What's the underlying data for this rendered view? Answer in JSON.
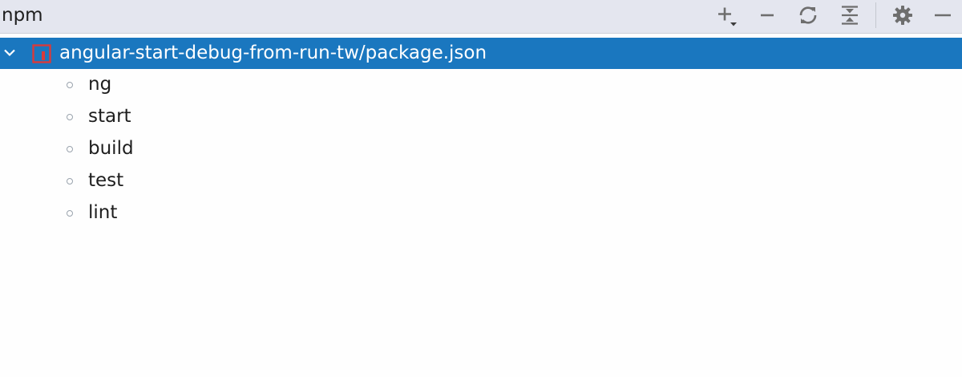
{
  "window": {
    "title": "npm"
  },
  "toolbar": {
    "icons": [
      "add-icon",
      "remove-icon",
      "reload-icon",
      "collapse-all-icon",
      "gear-icon",
      "hide-icon"
    ],
    "icon_color": "#6e6e6e"
  },
  "tree": {
    "root": {
      "label": "angular-start-debug-from-run-tw/package.json",
      "selected_color": "#1a77bf",
      "icon_color": "#d93a3a"
    },
    "scripts": [
      {
        "label": "ng"
      },
      {
        "label": "start"
      },
      {
        "label": "build"
      },
      {
        "label": "test"
      },
      {
        "label": "lint"
      }
    ]
  }
}
